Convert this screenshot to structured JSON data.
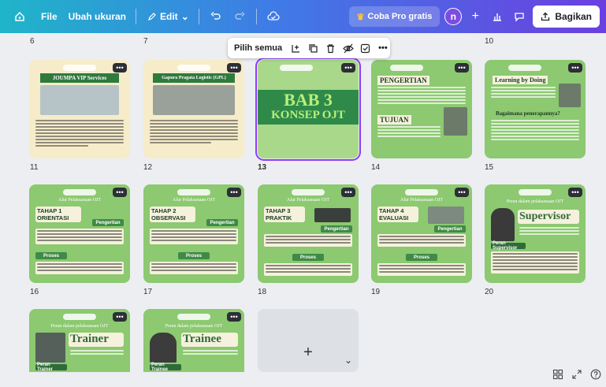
{
  "topbar": {
    "file_label": "File",
    "resize_label": "Ubah ukuran",
    "edit_label": "Edit",
    "pro_label": "Coba Pro gratis",
    "avatar_initial": "n",
    "share_label": "Bagikan"
  },
  "selection_toolbar": {
    "select_all_label": "Pilih semua",
    "more_label": "•••"
  },
  "grid": {
    "row_numbers_top": [
      "6",
      "7",
      "10"
    ],
    "rows": [
      {
        "numbers": [
          "11",
          "12",
          "13",
          "14",
          "15"
        ]
      },
      {
        "numbers": [
          "16",
          "17",
          "18",
          "19",
          "20"
        ]
      }
    ],
    "cards": [
      {
        "title": "JOUMPA VIP Services"
      },
      {
        "title": "Gapura Pragata Logistic (GPL)"
      },
      {
        "title_line1": "BAB 3",
        "title_line2": "KONSEP OJT"
      },
      {
        "title": "PENGERTIAN",
        "subtitle": "TUJUAN"
      },
      {
        "title": "Learning by Doing",
        "subtitle": "Bagaimana penerapannya?"
      },
      {
        "header": "Alur Pelaksanaan OJT",
        "title": "TAHAP 1 ORIENTASI",
        "label1": "Pengertian",
        "label2": "Proses"
      },
      {
        "header": "Alur Pelaksanaan OJT",
        "title": "TAHAP 2 OBSERVASI",
        "label1": "Pengertian",
        "label2": "Proses"
      },
      {
        "header": "Alur Pelaksanaan OJT",
        "title": "TAHAP 3 PRAKTIK",
        "label1": "Pengertian",
        "label2": "Proses"
      },
      {
        "header": "Alur Pelaksanaan OJT",
        "title": "TAHAP 4 EVALUASI",
        "label1": "Pengertian",
        "label2": "Proses"
      },
      {
        "header": "Peran dalam pelaksanaan OJT",
        "title": "Supervisor",
        "label1": "Peran Supervisor"
      },
      {
        "header": "Peran dalam pelaksanaan OJT",
        "title": "Trainer",
        "label1": "Peran Trainer"
      },
      {
        "header": "Peran dalam pelaksanaan OJT",
        "title": "Trainee",
        "label1": "Peran Trainee"
      }
    ],
    "add_page_label": "+"
  },
  "colors": {
    "accent_purple": "#8b3dff",
    "card_green": "#8cc970",
    "card_cream": "#f6ecc9"
  }
}
